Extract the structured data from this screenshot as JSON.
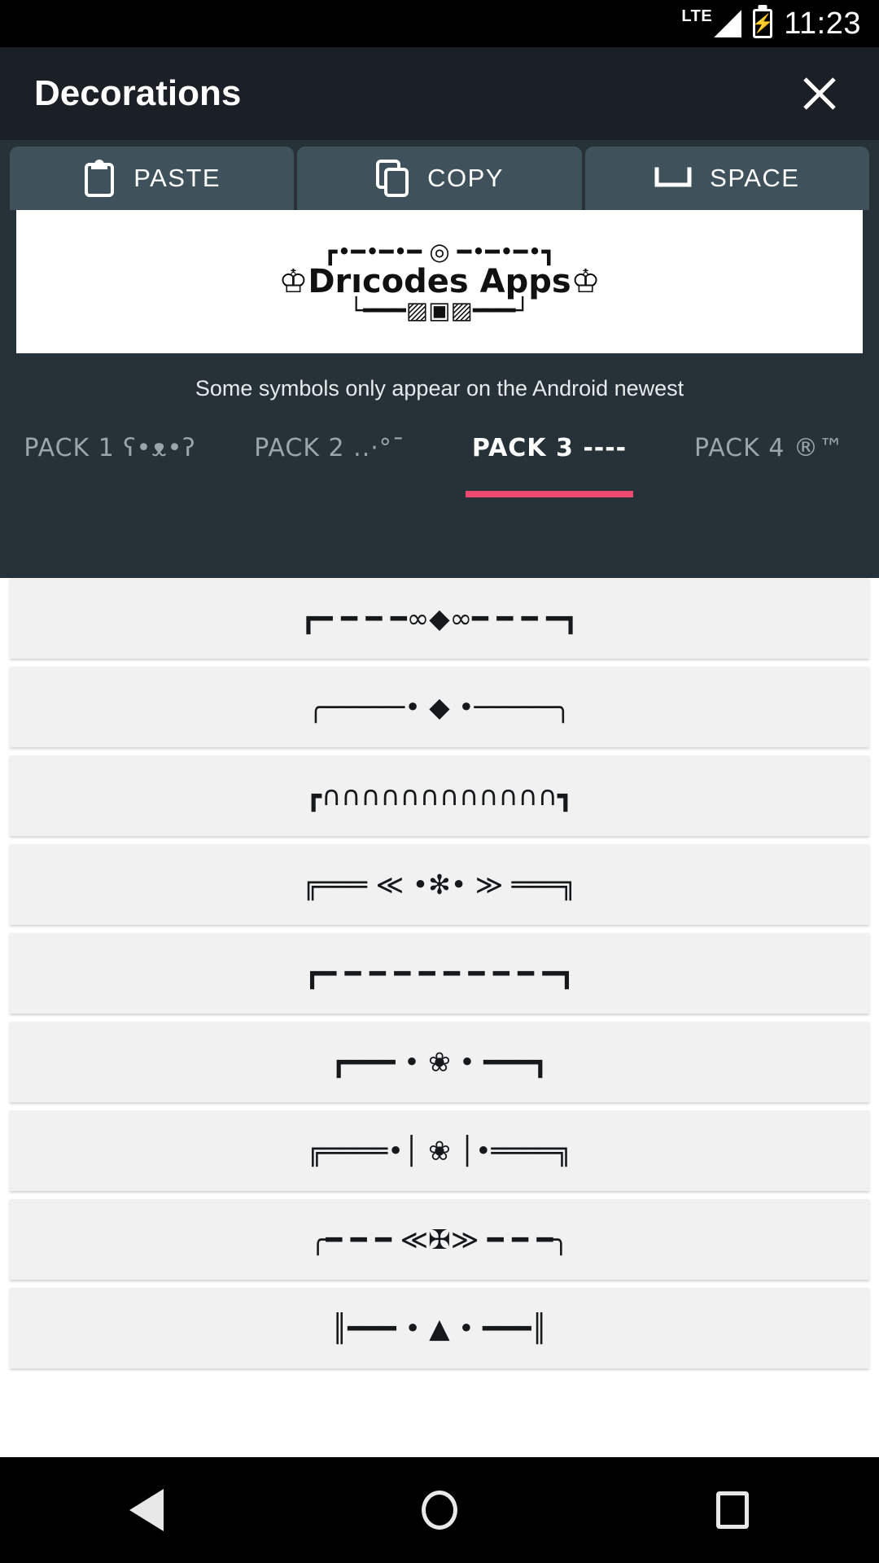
{
  "statusbar": {
    "network_label": "LTE",
    "time": "11:23",
    "signal_icon": "signal-triangle-icon",
    "battery_icon": "battery-charging-icon"
  },
  "appbar": {
    "title": "Decorations",
    "close_icon": "close-icon"
  },
  "actions": [
    {
      "label": "PASTE",
      "icon": "clipboard-icon"
    },
    {
      "label": "COPY",
      "icon": "copy-pages-icon"
    },
    {
      "label": "SPACE",
      "icon": "spacebar-icon"
    }
  ],
  "preview": {
    "line_top": "┏•━•━•━ ◎ ━•━•━•┓",
    "line_mid": "♔Drıcodes Apps♔",
    "line_bot": "└━━━▨▣▨━━━┘"
  },
  "hint": {
    "text": "Some symbols only appear on the Android newest"
  },
  "tabs": [
    {
      "label": "PACK 1 ʕ•ᴥ•ʔ",
      "active": false
    },
    {
      "label": "PACK 2 ..·°¯",
      "active": false
    },
    {
      "label": "PACK 3 ----",
      "active": true
    },
    {
      "label": "PACK 4 ®™",
      "active": false
    }
  ],
  "accent_color": "#ec4a70",
  "list": {
    "items": [
      {
        "art": "┏━ ━ ━ ━∞◆∞━ ━ ━ ━┓"
      },
      {
        "art": "╭─────• ◆ •─────╮"
      },
      {
        "art": "┏∩∩∩∩∩∩∩∩∩∩∩∩┓"
      },
      {
        "art": "╔═══ ≪ •✻• ≫ ═══╗"
      },
      {
        "art": "┏━ ━ ━ ━ ━ ━ ━ ━ ━ ━┓"
      },
      {
        "art": "┏━━━ • ❀ • ━━━┓"
      },
      {
        "art": "╔════•│ ❀ │•════╗"
      },
      {
        "art": "╭━ ━ ━ ≪✠≫ ━ ━ ━╮"
      },
      {
        "art": "║━━━ • ▲ • ━━━║"
      }
    ]
  },
  "navbar": {
    "back_icon": "triangle-back-icon",
    "home_icon": "circle-home-icon",
    "recents_icon": "square-recents-icon"
  }
}
